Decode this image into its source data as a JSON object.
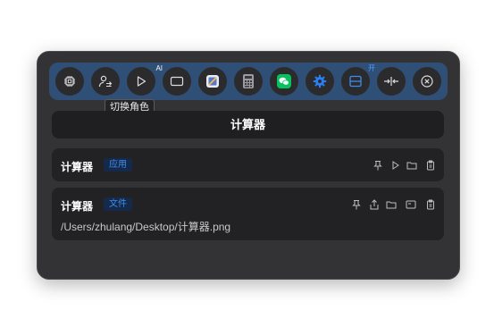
{
  "toolbar": {
    "buttons": [
      {
        "name": "chip-button",
        "icon": "chip-icon"
      },
      {
        "name": "switch-role-button",
        "icon": "person-switch-icon"
      },
      {
        "name": "play-ai-button",
        "icon": "play-icon",
        "badge": "AI"
      },
      {
        "name": "window-button",
        "icon": "rectangle-icon"
      },
      {
        "name": "app-button",
        "icon": "app-palette-icon"
      },
      {
        "name": "calculator-app-button",
        "icon": "calculator-icon"
      },
      {
        "name": "wechat-button",
        "icon": "wechat-icon"
      },
      {
        "name": "settings-button",
        "icon": "gear-icon"
      },
      {
        "name": "split-view-button",
        "icon": "split-icon",
        "badge": "开"
      },
      {
        "name": "merge-button",
        "icon": "arrows-inward-icon"
      },
      {
        "name": "close-button",
        "icon": "close-circle-icon"
      }
    ],
    "tooltip": "切换角色"
  },
  "query": "计算器",
  "results": [
    {
      "title": "计算器",
      "tag": "应用"
    },
    {
      "title": "计算器",
      "tag": "文件",
      "path": "/Users/zhulang/Desktop/计算器.png"
    }
  ],
  "colors": {
    "panel": "#333335",
    "toolbar": "#2f4f77",
    "tag_text": "#3c8bf0",
    "tag_bg": "#152a4a",
    "wechat": "#07c160",
    "settings": "#2a7ff2"
  }
}
